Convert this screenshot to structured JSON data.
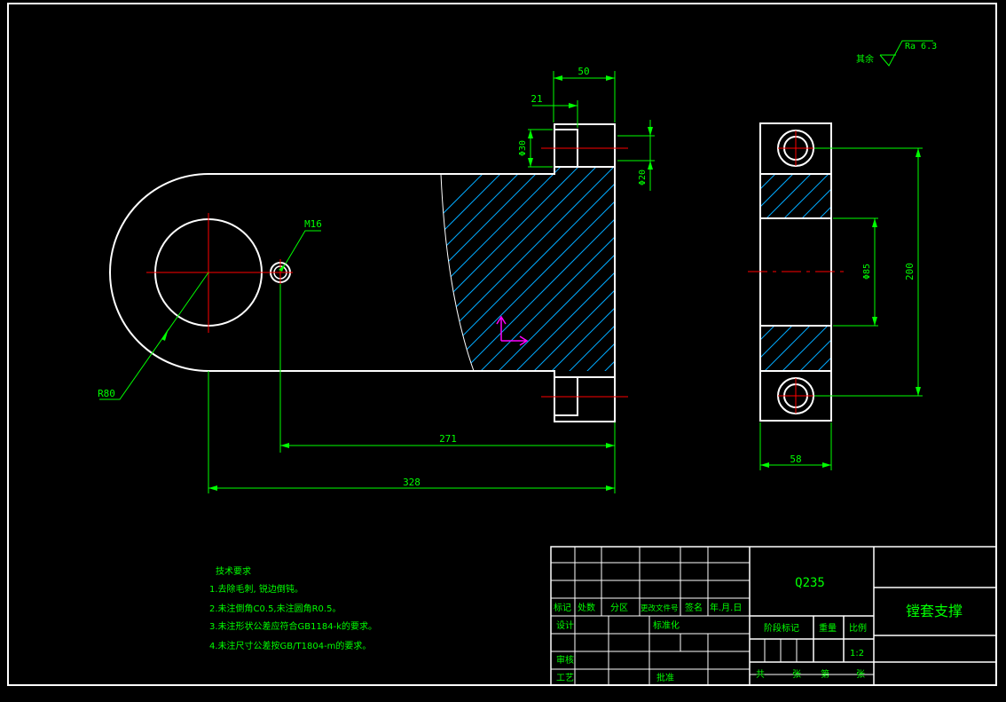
{
  "drawing": {
    "dims": {
      "d50": "50",
      "d21": "21",
      "d30": "Φ30",
      "d20": "Φ20",
      "m16": "M16",
      "r80": "R80",
      "d271": "271",
      "d328": "328",
      "d85": "Φ85",
      "d200": "200",
      "d58": "58"
    },
    "roughness": {
      "prefix": "其余",
      "value": "Ra 6.3"
    },
    "tech_requirements": {
      "title": "技术要求",
      "items": [
        "1.去除毛刺, 锐边倒钝。",
        "2.未注倒角C0.5,未注圆角R0.5。",
        "3.未注形状公差应符合GB1184-k的要求。",
        "4.未注尺寸公差按GB/T1804-m的要求。"
      ]
    },
    "title_block": {
      "material": "Q235",
      "part_name": "镗套支撑",
      "labels": {
        "mark": "标记",
        "count": "处数",
        "zone": "分区",
        "change_doc": "更改文件号",
        "sign": "签名",
        "date": "年.月.日",
        "design": "设计",
        "standardize": "标准化",
        "stage_mark": "阶段标记",
        "weight": "重量",
        "scale": "比例",
        "review": "审核",
        "process": "工艺",
        "approve": "批准",
        "total": "共",
        "sheet": "张",
        "page": "第",
        "sheet2": "张"
      },
      "scale_value": "1:2"
    },
    "colors": {
      "outline": "#ffffff",
      "dimension": "#00ff00",
      "hatch": "#00aaff",
      "center": "#ff0000",
      "text": "#00ff00",
      "ucs": "#ff00ff"
    }
  }
}
